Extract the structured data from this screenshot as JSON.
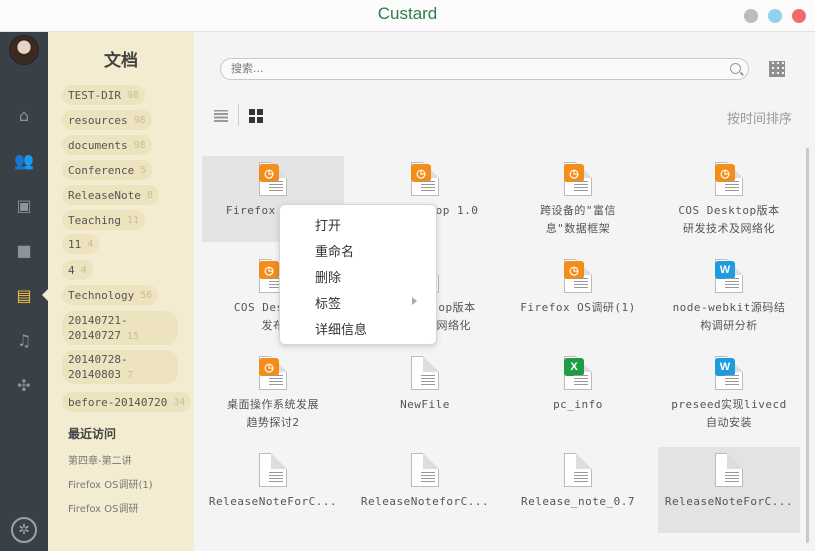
{
  "window": {
    "title": "Custard"
  },
  "colors": {
    "sidebar_bg": "#f3ecd1",
    "iconbar_bg": "#3a4146",
    "active_icon": "#f3c33f",
    "title_text": "#2e7d4a"
  },
  "iconbar": {
    "items": [
      {
        "icon": "home-icon"
      },
      {
        "icon": "contacts-icon"
      },
      {
        "icon": "photos-icon"
      },
      {
        "icon": "videos-icon"
      },
      {
        "icon": "documents-icon",
        "active": true
      },
      {
        "icon": "music-icon"
      },
      {
        "icon": "apps-icon"
      }
    ]
  },
  "sidebar": {
    "title": "文档",
    "tags": [
      {
        "label": "TEST-DIR",
        "count": "98"
      },
      {
        "label": "resources",
        "count": "98"
      },
      {
        "label": "documents",
        "count": "98"
      },
      {
        "label": "Conference",
        "count": "5"
      },
      {
        "label": "ReleaseNote",
        "count": "8"
      },
      {
        "label": "Teaching",
        "count": "11"
      },
      {
        "label": "11",
        "count": "4"
      },
      {
        "label": "4",
        "count": "4"
      },
      {
        "label": "Technology",
        "count": "56"
      },
      {
        "label_line1": "20140721-",
        "label_line2": "20140727",
        "count": "15"
      },
      {
        "label_line1": "20140728-",
        "label_line2": "20140803",
        "count": "7"
      },
      {
        "label": "before-20140720",
        "count": "34"
      }
    ],
    "recent_title": "最近访问",
    "recent": [
      "第四章-第二讲",
      "Firefox OS调研(1)",
      "Firefox OS调研"
    ]
  },
  "toolbar": {
    "search_placeholder": "搜索...",
    "sort_label": "按时间排序"
  },
  "files": [
    {
      "line1": "Firefox OS调研",
      "line2": "",
      "type": "ppt",
      "selected": true
    },
    {
      "line1": "COS Desktop 1.0",
      "line2": "",
      "type": "ppt"
    },
    {
      "line1": "跨设备的\"富信",
      "line2": "息\"数据框架",
      "type": "ppt"
    },
    {
      "line1": "COS Desktop版本",
      "line2": "研发技术及网络化",
      "type": "ppt"
    },
    {
      "line1": "COS Desktop",
      "line2": "发布",
      "type": "ppt"
    },
    {
      "line1": "COS Desktop版本",
      "line2": "研发技术及网络化",
      "type": "ppt"
    },
    {
      "line1": "Firefox OS调研(1)",
      "line2": "",
      "type": "ppt"
    },
    {
      "line1": "node-webkit源码结",
      "line2": "构调研分析",
      "type": "word"
    },
    {
      "line1": "桌面操作系统发展",
      "line2": "趋势探讨2",
      "type": "ppt"
    },
    {
      "line1": "NewFile",
      "line2": "",
      "type": "plain"
    },
    {
      "line1": "pc_info",
      "line2": "",
      "type": "excel"
    },
    {
      "line1": "preseed实现livecd",
      "line2": "自动安装",
      "type": "word"
    },
    {
      "line1": "ReleaseNoteForC...",
      "line2": "",
      "type": "plain"
    },
    {
      "line1": "ReleaseNoteforC...",
      "line2": "",
      "type": "plain"
    },
    {
      "line1": "Release_note_0.7",
      "line2": "",
      "type": "plain"
    },
    {
      "line1": "ReleaseNoteForC...",
      "line2": "",
      "type": "plain",
      "selected": true
    }
  ],
  "file_badges": {
    "ppt": "◷",
    "word": "W",
    "excel": "X"
  },
  "context_menu": {
    "items": [
      "打开",
      "重命名",
      "删除",
      "标签",
      "详细信息"
    ]
  }
}
